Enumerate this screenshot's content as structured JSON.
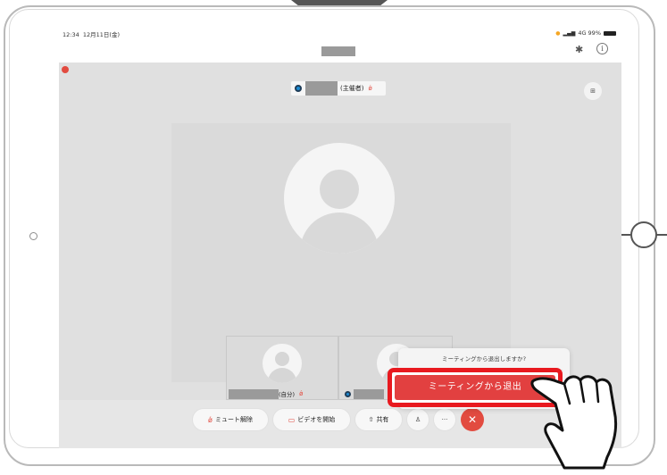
{
  "status_bar": {
    "time": "12:34",
    "date": "12月11日(金)",
    "network": "4G 99%"
  },
  "meeting": {
    "host_suffix": "(主催者)",
    "self_suffix": "(自分)"
  },
  "leave_popup": {
    "question": "ミーティングから退出しますか?",
    "leave_button": "ミーティングから退出"
  },
  "toolbar": {
    "unmute_label": "ミュート解除",
    "start_video_label": "ビデオを開始",
    "share_label": "共有",
    "more_label": "···"
  },
  "colors": {
    "highlight": "#e8191f",
    "leave": "#e24040",
    "end_call": "#e24b40",
    "video_bg": "#e0e0e0"
  }
}
